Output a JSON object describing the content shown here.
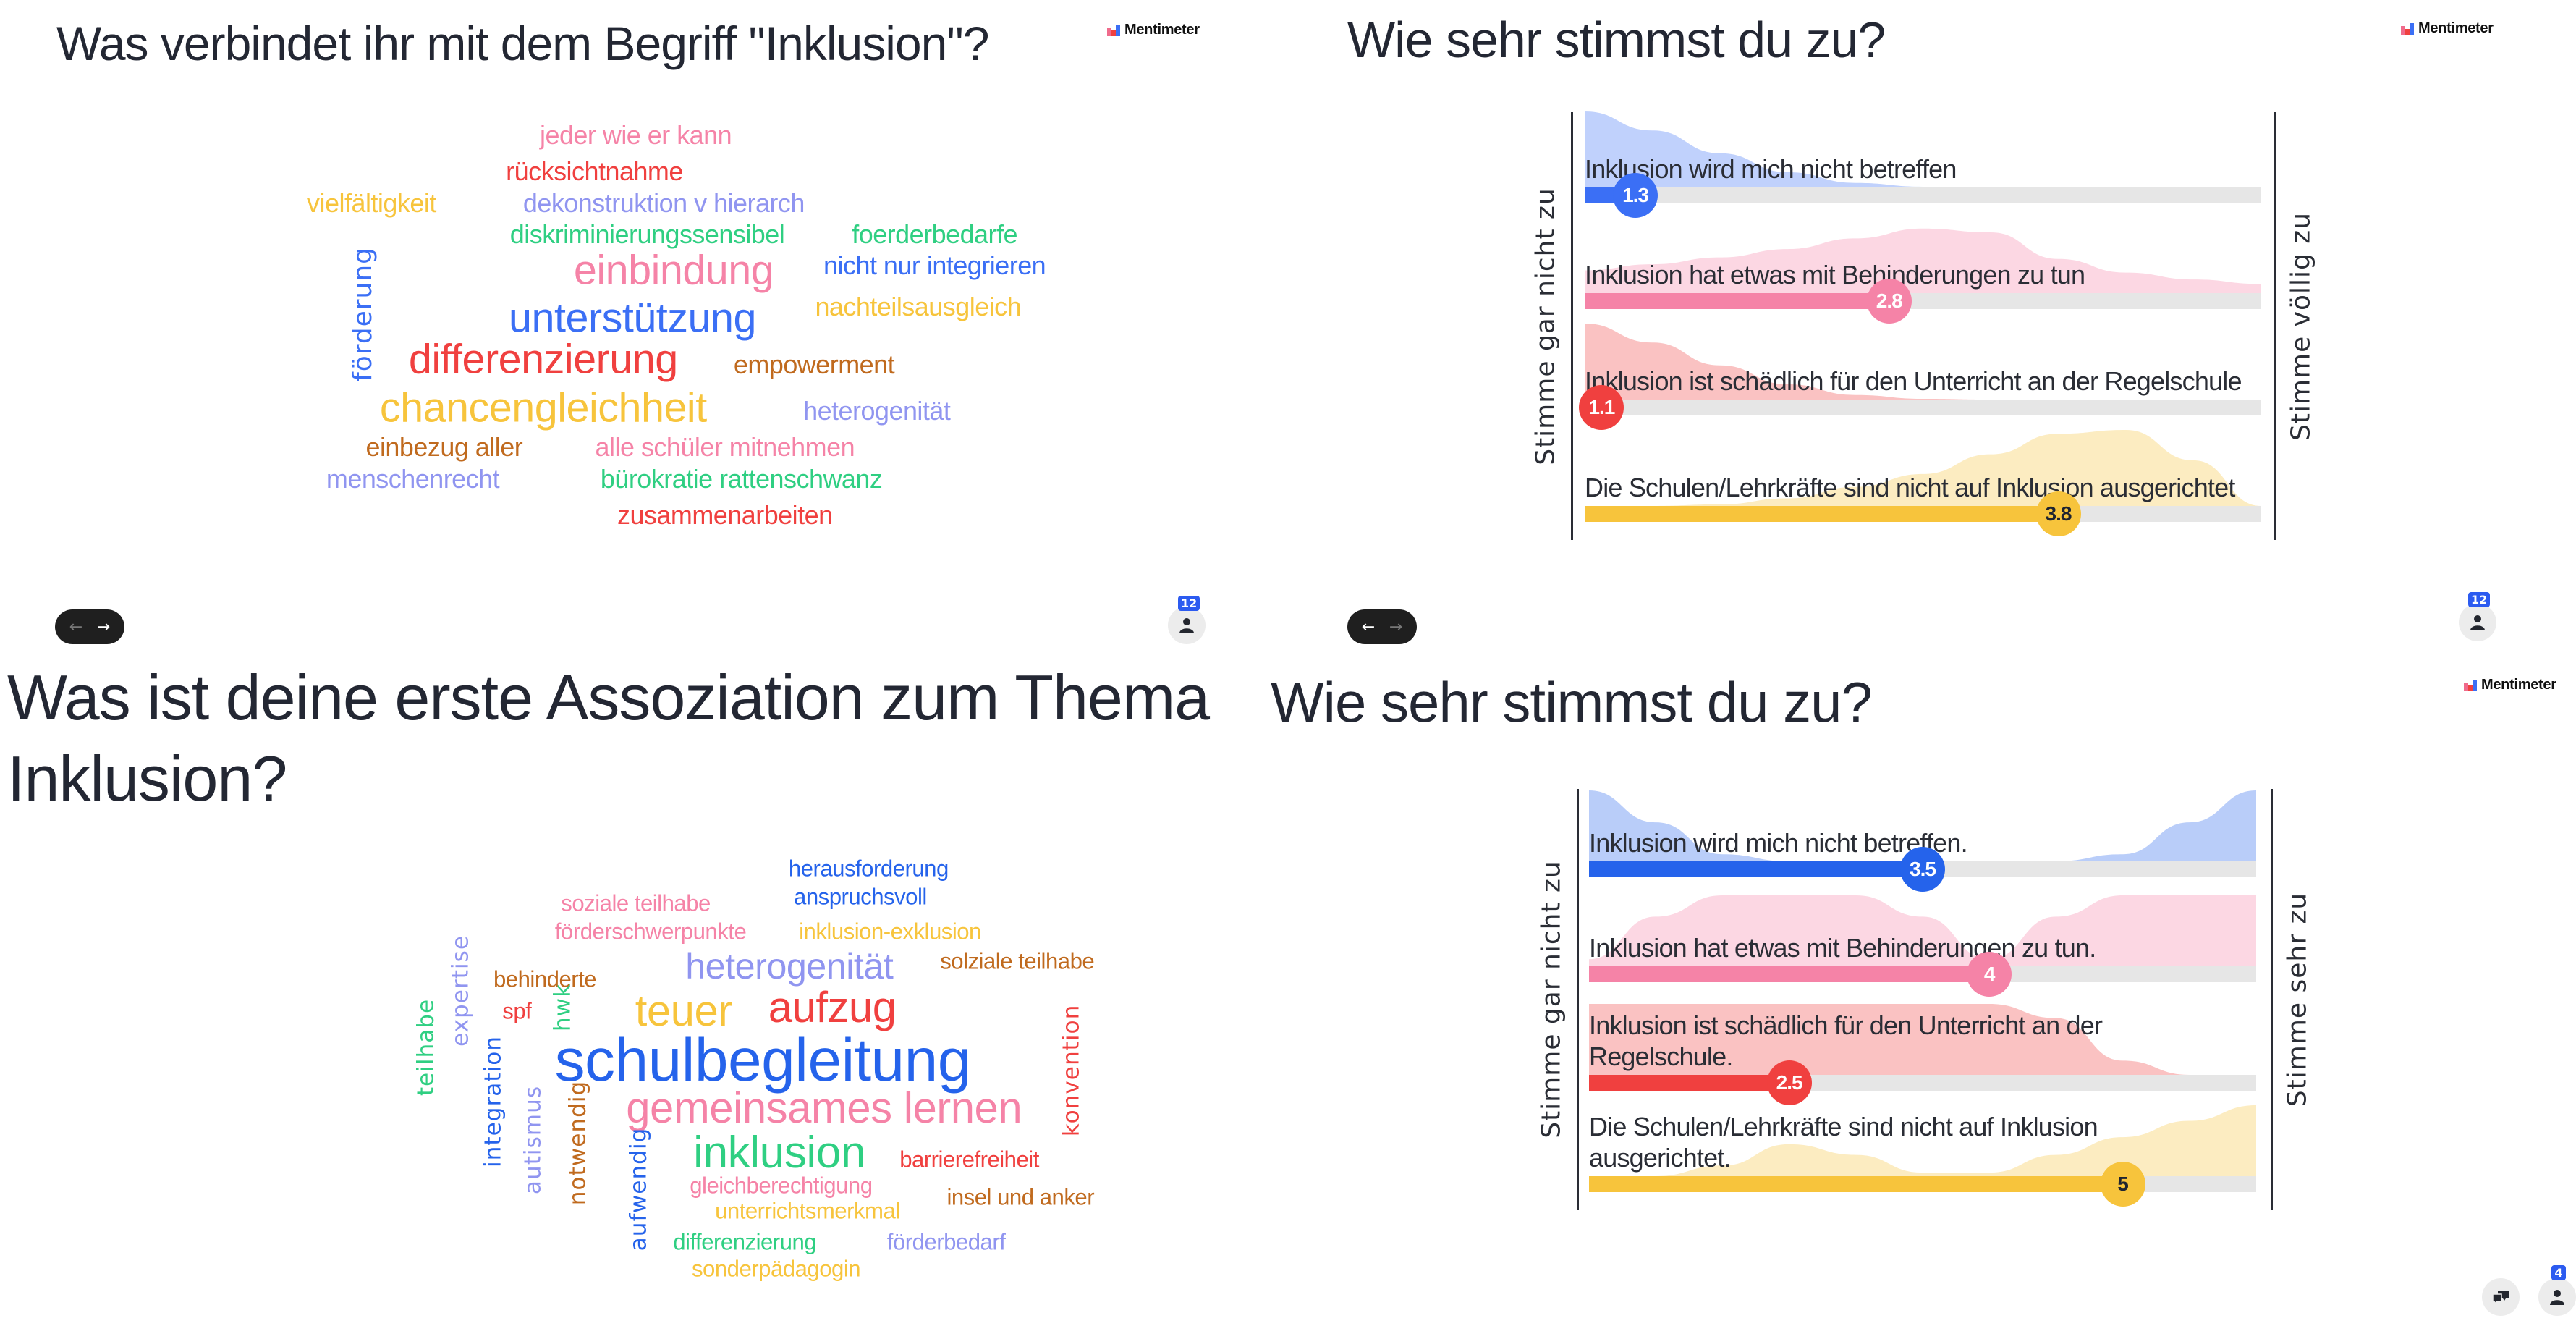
{
  "colors": {
    "blue": "#3b6ff5",
    "pink": "#f583a7",
    "red": "#f0403f",
    "yellow": "#f7c43c",
    "lavender": "#9095f0",
    "green": "#2fcf82",
    "brown": "#c06a1e",
    "dark_blue": "#2563eb",
    "title": "#232733",
    "badge": "#2c5bf0",
    "track": "#e6e6e6"
  },
  "logo_text": "Mentimeter",
  "slides": [
    {
      "id": "top-left",
      "title": "Was verbindet ihr mit dem Begriff \"Inklusion\"?",
      "type": "wordcloud",
      "words": [
        {
          "text": "jeder wie er kann",
          "color": "pink",
          "weight": 1
        },
        {
          "text": "rücksichtnahme",
          "color": "red",
          "weight": 1
        },
        {
          "text": "vielfältigkeit",
          "color": "yellow",
          "weight": 1
        },
        {
          "text": "dekonstruktion v hierarch",
          "color": "lavender",
          "weight": 1
        },
        {
          "text": "diskriminierungssensibel",
          "color": "green",
          "weight": 1
        },
        {
          "text": "foerderbedarfe",
          "color": "green",
          "weight": 1
        },
        {
          "text": "einbindung",
          "color": "pink",
          "weight": 2
        },
        {
          "text": "nicht nur integrieren",
          "color": "blue",
          "weight": 1
        },
        {
          "text": "förderung",
          "color": "blue",
          "weight": 1,
          "vertical": true
        },
        {
          "text": "unterstützung",
          "color": "blue",
          "weight": 2
        },
        {
          "text": "nachteilsausgleich",
          "color": "yellow",
          "weight": 1
        },
        {
          "text": "differenzierung",
          "color": "red",
          "weight": 2
        },
        {
          "text": "empowerment",
          "color": "brown",
          "weight": 1
        },
        {
          "text": "chancengleichheit",
          "color": "yellow",
          "weight": 2
        },
        {
          "text": "heterogenität",
          "color": "lavender",
          "weight": 1
        },
        {
          "text": "einbezug aller",
          "color": "brown",
          "weight": 1
        },
        {
          "text": "alle schüler mitnehmen",
          "color": "pink",
          "weight": 1
        },
        {
          "text": "menschenrecht",
          "color": "lavender",
          "weight": 1
        },
        {
          "text": "bürokratie rattenschwanz",
          "color": "green",
          "weight": 1
        },
        {
          "text": "zusammenarbeiten",
          "color": "red",
          "weight": 1
        }
      ]
    },
    {
      "id": "top-right",
      "title": "Wie sehr stimmst du zu?",
      "type": "scales",
      "left_label": "Stimme gar nicht zu",
      "right_label": "Stimme völlig zu",
      "participants": "12"
    },
    {
      "id": "bottom-left",
      "title_line1": "Was ist deine erste Assoziation zum Thema",
      "title_line2": "Inklusion?",
      "type": "wordcloud",
      "participants": "12",
      "words": [
        {
          "text": "herausforderung",
          "color": "dark_blue",
          "weight": 1
        },
        {
          "text": "anspruchsvoll",
          "color": "dark_blue",
          "weight": 1
        },
        {
          "text": "soziale teilhabe",
          "color": "pink",
          "weight": 1
        },
        {
          "text": "förderschwerpunkte",
          "color": "pink",
          "weight": 1
        },
        {
          "text": "inklusion-exklusion",
          "color": "yellow",
          "weight": 1
        },
        {
          "text": "heterogenität",
          "color": "lavender",
          "weight": 2
        },
        {
          "text": "solziale teilhabe",
          "color": "brown",
          "weight": 1
        },
        {
          "text": "behinderte",
          "color": "brown",
          "weight": 1
        },
        {
          "text": "expertise",
          "color": "lavender",
          "weight": 1,
          "vertical": true
        },
        {
          "text": "spf",
          "color": "red",
          "weight": 1
        },
        {
          "text": "hwk",
          "color": "green",
          "weight": 1,
          "vertical": true
        },
        {
          "text": "teuer",
          "color": "yellow",
          "weight": 3
        },
        {
          "text": "aufzug",
          "color": "red",
          "weight": 3
        },
        {
          "text": "teilhabe",
          "color": "green",
          "weight": 1,
          "vertical": true
        },
        {
          "text": "schulbegleitung",
          "color": "dark_blue",
          "weight": 4
        },
        {
          "text": "konvention",
          "color": "red",
          "weight": 1,
          "vertical": true
        },
        {
          "text": "integration",
          "color": "dark_blue",
          "weight": 1,
          "vertical": true
        },
        {
          "text": "gemeinsames lernen",
          "color": "pink",
          "weight": 3
        },
        {
          "text": "autismus",
          "color": "lavender",
          "weight": 1,
          "vertical": true
        },
        {
          "text": "notwendig",
          "color": "brown",
          "weight": 1,
          "vertical": true
        },
        {
          "text": "inklusion",
          "color": "green",
          "weight": 3
        },
        {
          "text": "barrierefreiheit",
          "color": "red",
          "weight": 1
        },
        {
          "text": "aufwendig",
          "color": "dark_blue",
          "weight": 1,
          "vertical": true
        },
        {
          "text": "gleichberechtigung",
          "color": "pink",
          "weight": 1
        },
        {
          "text": "insel und anker",
          "color": "brown",
          "weight": 1
        },
        {
          "text": "unterrichtsmerkmal",
          "color": "yellow",
          "weight": 1
        },
        {
          "text": "differenzierung",
          "color": "green",
          "weight": 1
        },
        {
          "text": "förderbedarf",
          "color": "lavender",
          "weight": 1
        },
        {
          "text": "sonderpädagogin",
          "color": "yellow",
          "weight": 1
        }
      ]
    },
    {
      "id": "bottom-right",
      "title": "Wie sehr stimmst du zu?",
      "type": "scales",
      "left_label": "Stimme gar nicht zu",
      "right_label": "Stimme sehr zu",
      "participants": "12",
      "viewers": "4"
    }
  ],
  "chart_data": [
    {
      "type": "bar",
      "title": "Wie sehr stimmst du zu?",
      "xlabel": "Stimme gar nicht zu → Stimme völlig zu",
      "ylabel": "",
      "xlim": [
        1,
        5
      ],
      "categories": [
        "Inklusion wird mich nicht betreffen",
        "Inklusion hat etwas mit Behinderungen zu tun",
        "Inklusion ist schädlich für den Unterricht an der Regelschule",
        "Die Schulen/Lehrkräfte sind nicht auf Inklusion ausgerichtet"
      ],
      "values": [
        1.3,
        2.8,
        1.1,
        3.8
      ],
      "value_labels": [
        "1.3",
        "2.8",
        "1.1",
        "3.8"
      ],
      "series_colors": [
        "blue",
        "pink",
        "red",
        "yellow"
      ],
      "distribution_shape": [
        "peak-left",
        "peak-middle",
        "peak-left",
        "peak-right"
      ]
    },
    {
      "type": "bar",
      "title": "Wie sehr stimmst du zu?",
      "xlabel": "Stimme gar nicht zu → Stimme sehr zu",
      "ylabel": "",
      "xlim": [
        1,
        6
      ],
      "categories": [
        "Inklusion wird mich nicht betreffen.",
        "Inklusion hat etwas mit Behinderungen zu tun.",
        "Inklusion ist schädlich für den Unterricht an der Regelschule.",
        "Die Schulen/Lehrkräfte sind nicht auf Inklusion ausgerichtet."
      ],
      "values": [
        3.5,
        4,
        2.5,
        5
      ],
      "value_labels": [
        "3.5",
        "4",
        "2.5",
        "5"
      ],
      "series_colors": [
        "dark_blue",
        "pink",
        "red",
        "yellow"
      ],
      "distribution_shape": [
        "bimodal-extremes",
        "bimodal-plateaus",
        "plateau-left",
        "bimodal-right"
      ]
    }
  ]
}
